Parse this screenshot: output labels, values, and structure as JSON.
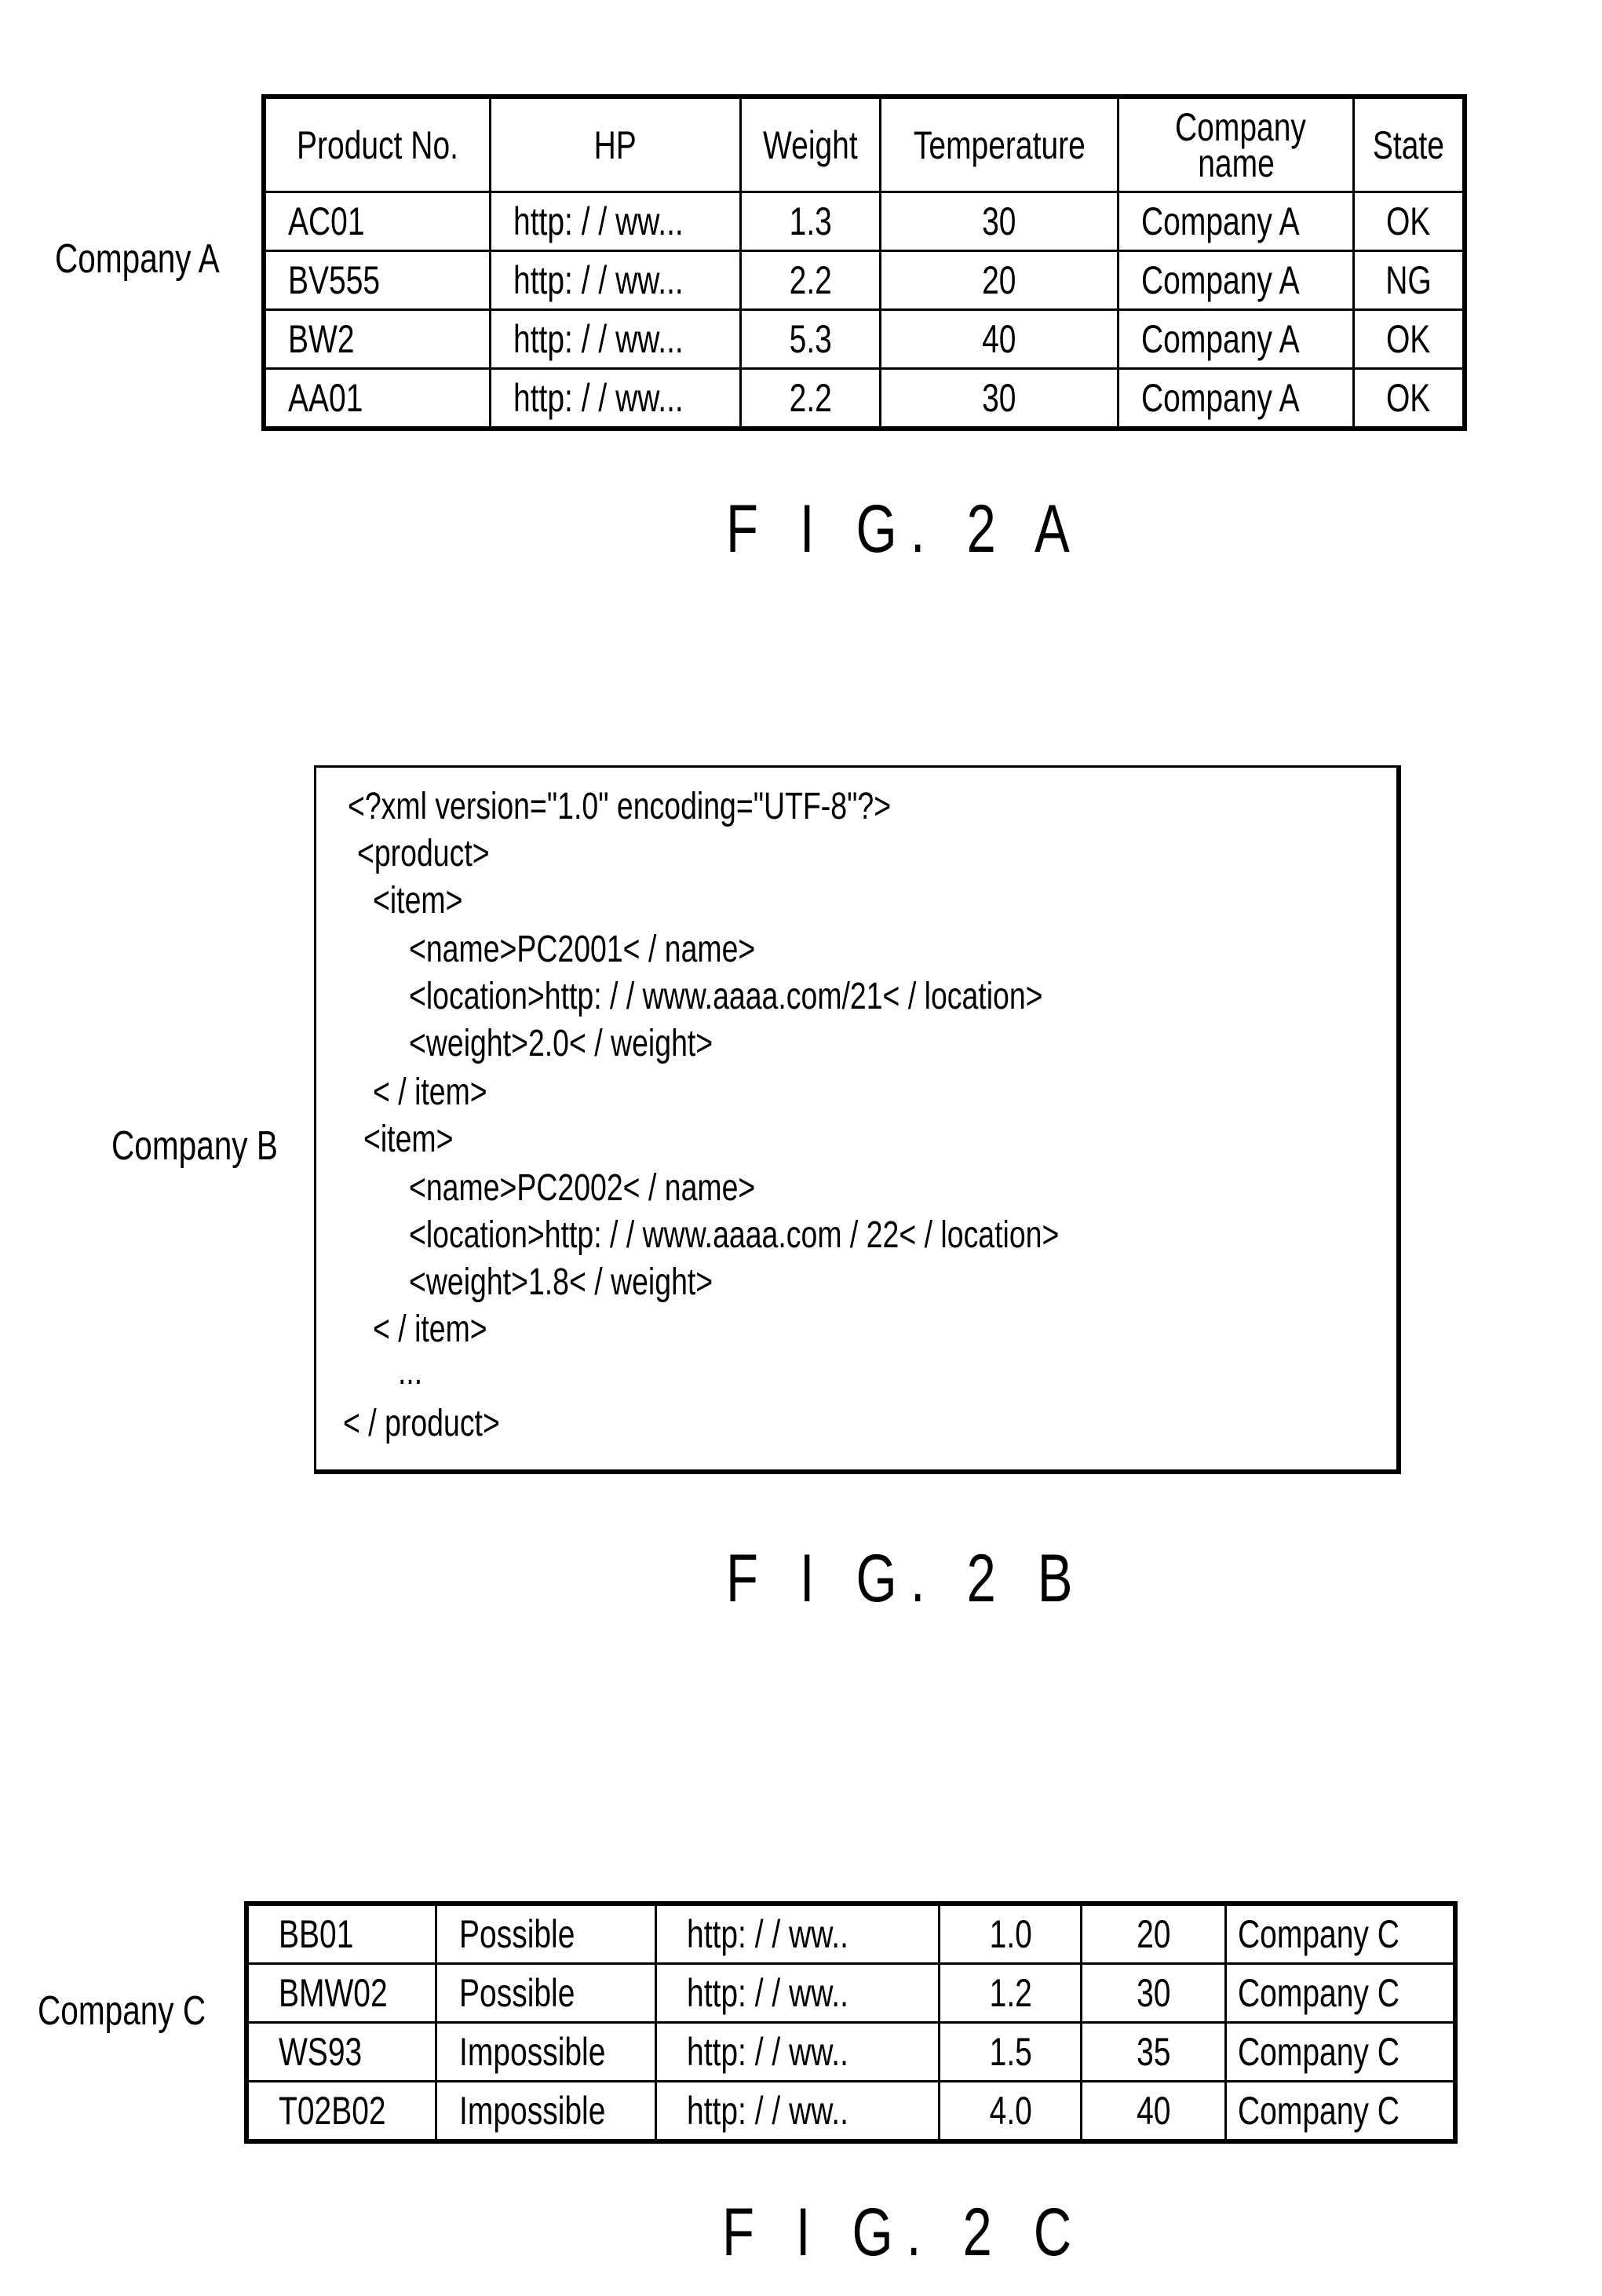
{
  "fig2a": {
    "side_label": "Company A",
    "caption": "F I G. 2 A",
    "headers": [
      "Product No.",
      "HP",
      "Weight",
      "Temperature",
      "Company name",
      "State"
    ],
    "rows": [
      [
        "AC01",
        "http: / / ww...",
        "1.3",
        "30",
        "Company  A",
        "OK"
      ],
      [
        "BV555",
        "http: / / ww...",
        "2.2",
        "20",
        "Company  A",
        "NG"
      ],
      [
        "BW2",
        "http: / / ww...",
        "5.3",
        "40",
        "Company  A",
        "OK"
      ],
      [
        "AA01",
        "http: / / ww...",
        "2.2",
        "30",
        "Company  A",
        "OK"
      ]
    ]
  },
  "fig2b": {
    "side_label": "Company B",
    "caption": "F I G. 2 B",
    "xml_lines": [
      "<?xml version=\"1.0\" encoding=\"UTF-8\"?>",
      "<product>",
      "<item>",
      "<name>PC2001< / name>",
      "<location>http: / / www.aaaa.com/21< / location>",
      "<weight>2.0< / weight>",
      "< / item>",
      "<item>",
      "<name>PC2002< / name>",
      "<location>http: / / www.aaaa.com / 22< / location>",
      "<weight>1.8< / weight>",
      "<  / item>",
      "...",
      "< / product>"
    ]
  },
  "fig2c": {
    "side_label": "Company C",
    "caption": "F I G. 2 C",
    "rows": [
      [
        "BB01",
        "Possible",
        "http: / / ww..",
        "1.0",
        "20",
        "Company  C"
      ],
      [
        "BMW02",
        "Possible",
        "http: / / ww..",
        "1.2",
        "30",
        "Company  C"
      ],
      [
        "WS93",
        "Impossible",
        "http: / / ww..",
        "1.5",
        "35",
        "Company  C"
      ],
      [
        "T02B02",
        "Impossible",
        "http: / / ww..",
        "4.0",
        "40",
        "Company  C"
      ]
    ]
  }
}
